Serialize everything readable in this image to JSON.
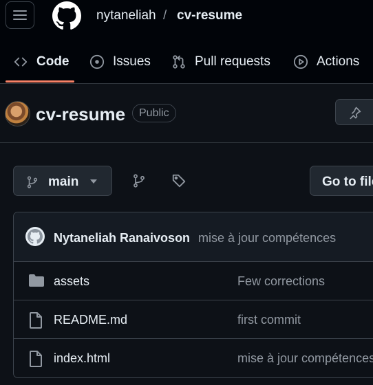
{
  "header": {
    "owner": "nytaneliah",
    "separator": "/",
    "repo": "cv-resume"
  },
  "tabs": [
    {
      "label": "Code",
      "icon": "code-icon",
      "selected": true
    },
    {
      "label": "Issues",
      "icon": "issue-opened-icon",
      "selected": false
    },
    {
      "label": "Pull requests",
      "icon": "git-pull-request-icon",
      "selected": false
    },
    {
      "label": "Actions",
      "icon": "play-icon",
      "selected": false
    }
  ],
  "repo_header": {
    "title": "cv-resume",
    "visibility": "Public"
  },
  "toolbar": {
    "branch": "main",
    "goto_file": "Go to file"
  },
  "latest_commit": {
    "author": "Nytaneliah Ranaivoson",
    "message": "mise à jour compétences"
  },
  "files": [
    {
      "type": "folder",
      "name": "assets",
      "commit": "Few corrections"
    },
    {
      "type": "file",
      "name": "README.md",
      "commit": "first commit"
    },
    {
      "type": "file",
      "name": "index.html",
      "commit": "mise à jour compétences"
    }
  ],
  "colors": {
    "background": "#0d1117",
    "header_background": "#010409",
    "border": "#3d444d",
    "selected_tab_underline": "#f78166",
    "muted_text": "#9198a1"
  }
}
